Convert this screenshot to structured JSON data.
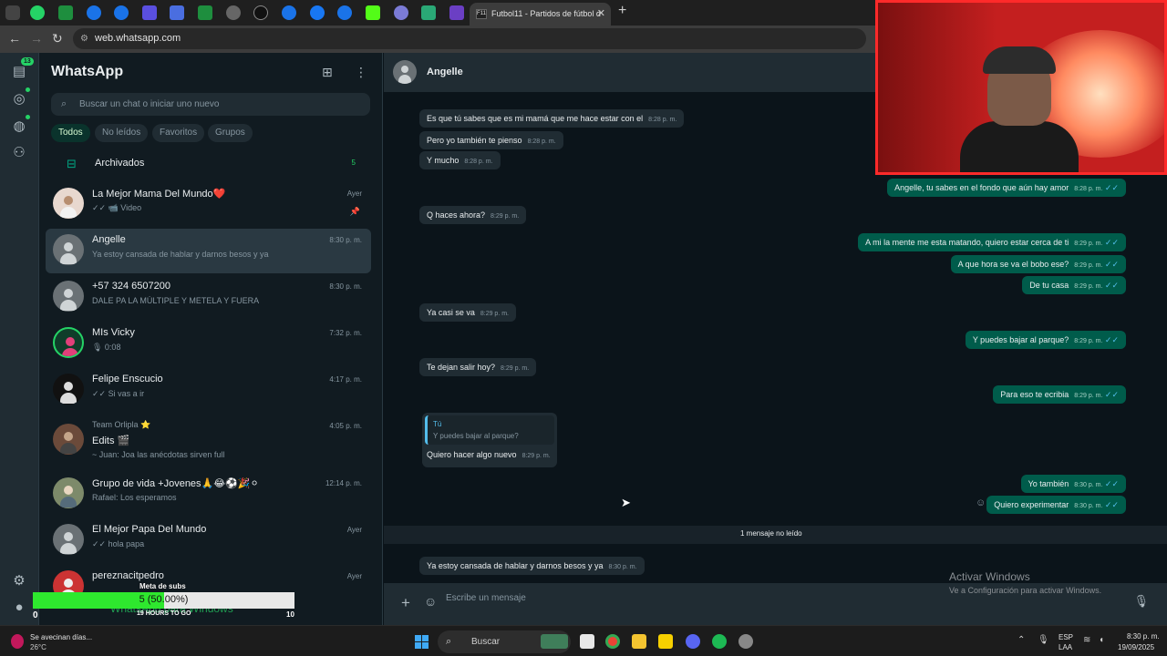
{
  "browser": {
    "active_tab_title": "Futbol11 - Partidos de fútbol d",
    "active_tab_favicon": "F11",
    "url": "web.whatsapp.com"
  },
  "rail": {
    "chats_badge": "13"
  },
  "list": {
    "app_title": "WhatsApp",
    "search_placeholder": "Buscar un chat o iniciar uno nuevo",
    "filters": [
      "Todos",
      "No leídos",
      "Favoritos",
      "Grupos"
    ],
    "archived_label": "Archivados",
    "archived_count": "5",
    "chats": [
      {
        "name": "La Mejor Mama Del Mundo❤️",
        "preview": "✓✓ 📹 Video",
        "time": "Ayer"
      },
      {
        "name": "Angelle",
        "preview": "Ya estoy cansada de hablar y darnos besos y ya",
        "time": "8:30 p. m."
      },
      {
        "name": "+57 324 6507200",
        "preview": "DALE PA LA MÚLTIPLE Y METELA Y FUERA",
        "time": "8:30 p. m."
      },
      {
        "name": "MIs Vicky",
        "preview": "🎙 0:08",
        "time": "7:32 p. m."
      },
      {
        "name": "Felipe Enscucio",
        "preview": "✓✓ Si vas a ir",
        "time": "4:17 p. m."
      },
      {
        "name": "Team Orlipla ⭐",
        "name2": "Edits 🎬",
        "preview": "~ Juan: Joa las anécdotas sirven full",
        "time": "4:05 p. m."
      },
      {
        "name": "Grupo de vida +Jovenes🙏😂⚽🎉⚪",
        "preview": "Rafael: Los esperamos",
        "time": "12:14 p. m."
      },
      {
        "name": "El Mejor Papa Del Mundo",
        "preview": "✓✓ hola papa",
        "time": "Ayer"
      },
      {
        "name": "pereznacitpedro",
        "preview": "",
        "time": "Ayer"
      }
    ]
  },
  "conversation": {
    "contact": "Angelle",
    "messages": [
      {
        "dir": "in",
        "text": "Es que tú sabes que es mi mamá que me hace estar con el",
        "time": "8:28 p. m."
      },
      {
        "dir": "in",
        "text": "Pero yo también te pienso",
        "time": "8:28 p. m."
      },
      {
        "dir": "in",
        "text": "Y mucho",
        "time": "8:28 p. m."
      },
      {
        "dir": "out",
        "text": "Angelle, tu sabes en el fondo que aún hay amor",
        "time": "8:28 p. m."
      },
      {
        "dir": "in",
        "text": "Q haces ahora?",
        "time": "8:29 p. m."
      },
      {
        "dir": "out",
        "text": "A mi la mente me esta matando, quiero estar cerca de ti",
        "time": "8:29 p. m."
      },
      {
        "dir": "out",
        "text": "A que hora se va el bobo ese?",
        "time": "8:29 p. m."
      },
      {
        "dir": "out",
        "text": "De tu casa",
        "time": "8:29 p. m."
      },
      {
        "dir": "in",
        "text": "Ya casi se va",
        "time": "8:29 p. m."
      },
      {
        "dir": "out",
        "text": "Y puedes bajar al parque?",
        "time": "8:29 p. m."
      },
      {
        "dir": "in",
        "text": "Te dejan salir hoy?",
        "time": "8:29 p. m."
      },
      {
        "dir": "out",
        "text": "Para eso te ecribia",
        "time": "8:29 p. m."
      },
      {
        "dir": "out",
        "text": "Yo también",
        "time": "8:30 p. m."
      },
      {
        "dir": "out",
        "text": "Quiero experimentar",
        "time": "8:30 p. m."
      },
      {
        "dir": "in",
        "text": "Ya estoy cansada de hablar y darnos besos y ya",
        "time": "8:30 p. m."
      }
    ],
    "quote": {
      "author": "Tú",
      "quoted": "Y puedes bajar al parque?",
      "text": "Quiero hacer algo nuevo",
      "time": "8:29 p. m."
    },
    "unread_divider": "1 mensaje no leído",
    "composer_placeholder": "Escribe un mensaje"
  },
  "overlay": {
    "activate_title": "Activar Windows",
    "activate_sub": "Ve a Configuración para activar Windows.",
    "goal_title": "Meta de subs",
    "goal_text": "5 (50.00%)",
    "goal_progress": 0.5,
    "goal_min": "0",
    "goal_max": "10",
    "goal_hours": "19 HOURS TO GO",
    "wa_ad": "WhatsApp para Windows"
  },
  "taskbar": {
    "weather_line1": "Se avecinan días...",
    "weather_line2": "26°C",
    "search": "Buscar",
    "lang1": "ESP",
    "lang2": "LAA",
    "time": "8:30 p. m.",
    "date": "19/09/2025"
  }
}
